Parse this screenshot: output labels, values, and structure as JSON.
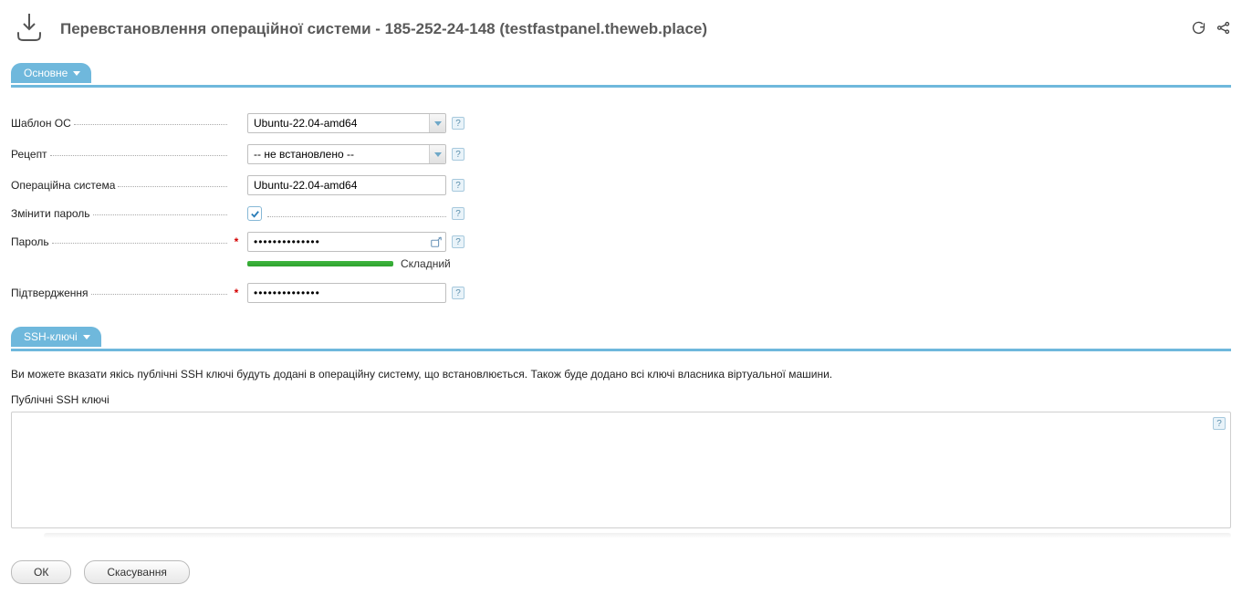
{
  "header": {
    "title": "Перевстановлення операційної системи - 185-252-24-148 (testfastpanel.theweb.place)"
  },
  "sections": {
    "main_tab": "Основне",
    "ssh_tab": "SSH-ключі"
  },
  "form": {
    "os_template": {
      "label": "Шаблон ОС",
      "value": "Ubuntu-22.04-amd64"
    },
    "recipe": {
      "label": "Рецепт",
      "value": "-- не встановлено --"
    },
    "os": {
      "label": "Операційна система",
      "value": "Ubuntu-22.04-amd64"
    },
    "change_password": {
      "label": "Змінити пароль",
      "checked": true
    },
    "password": {
      "label": "Пароль",
      "value": "••••••••••••••"
    },
    "password_strength": "Складний",
    "confirm": {
      "label": "Підтвердження",
      "value": "••••••••••••••"
    }
  },
  "ssh": {
    "description": "Ви можете вказати якісь публічні SSH ключі будуть додані в операційну систему, що встановлюється. Також буде додано всі ключі власника віртуальної машини.",
    "label": "Публічні SSH ключі",
    "value": ""
  },
  "buttons": {
    "ok": "ОК",
    "cancel": "Скасування"
  },
  "help": "?"
}
